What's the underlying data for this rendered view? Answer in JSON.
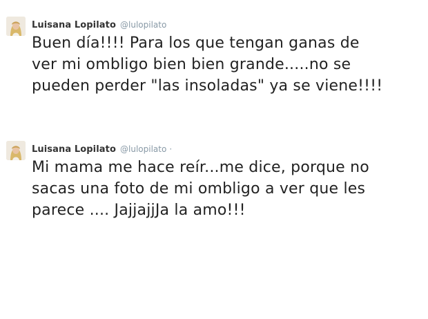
{
  "tweets": [
    {
      "name": "Luisana Lopilato",
      "handle": "@lulopilato",
      "text": "Buen día!!!! Para los que tengan ganas de\nver mi ombligo bien bien grande.....no se\npueden perder \"las insoladas\" ya se viene!!!!"
    },
    {
      "name": "Luisana Lopilato",
      "handle": "@lulopilato",
      "separator": "·",
      "text": "Mi mama me hace reír...me dice, porque no\nsacas una foto de mi ombligo a ver que les\nparece .... JajjajjJa la amo!!!"
    }
  ],
  "colors": {
    "name": "#333333",
    "handle": "#8899a6",
    "text": "#222222",
    "background": "#ffffff"
  },
  "icons": {
    "avatar": "profile-photo"
  }
}
